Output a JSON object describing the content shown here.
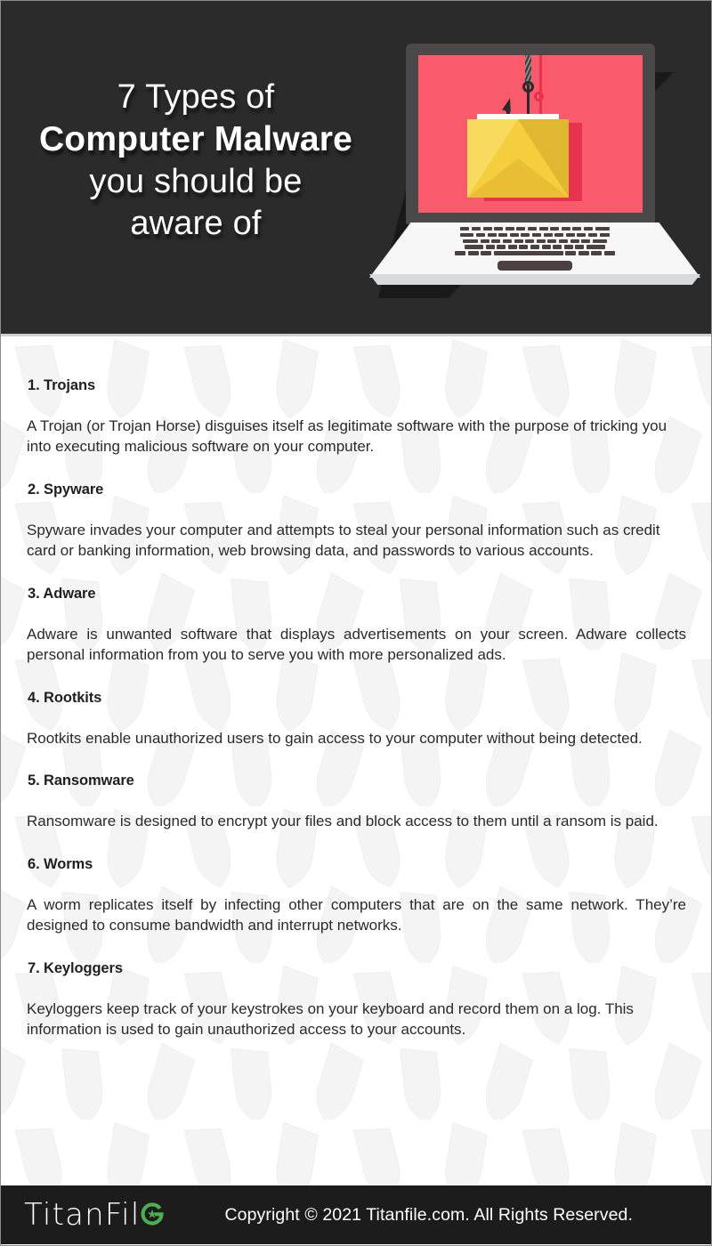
{
  "header": {
    "title_lines": [
      {
        "text": "7 Types of",
        "bold": false
      },
      {
        "text": "Computer Malware",
        "bold": true
      },
      {
        "text": "you should be",
        "bold": false
      },
      {
        "text": "aware of",
        "bold": false
      }
    ],
    "illustration": {
      "name": "phishing-email-laptop-illustration",
      "screen_color": "#fa5b6c",
      "envelope_color": "#f5ce3e",
      "hook_color": "#2b2b2b",
      "skull_color": "#2b2b2b",
      "laptop_body_color": "#f7f7f7",
      "lid_color": "#4b4849"
    },
    "background_color": "#2b2b2b"
  },
  "content": {
    "background_color": "#ffffff",
    "watermark_icon": "shield-icon",
    "sections": [
      {
        "title": "1. Trojans",
        "body": "A Trojan (or Trojan Horse) disguises itself as legitimate software with the purpose of tricking you into executing malicious software on your computer.",
        "justify": false
      },
      {
        "title": "2. Spyware",
        "body": "Spyware invades your computer and attempts to steal your personal information such as credit card or banking information, web browsing data, and passwords to various accounts.",
        "justify": false
      },
      {
        "title": "3. Adware",
        "body": "Adware is unwanted software that displays advertisements on your screen. Adware collects personal information from you to serve you with more personalized ads.",
        "justify": true
      },
      {
        "title": "4. Rootkits",
        "body": "Rootkits enable unauthorized users to gain access to your computer without being detected.",
        "justify": true
      },
      {
        "title": "5. Ransomware",
        "body": "Ransomware is designed to encrypt your files and block access to them until a ransom is paid.",
        "justify": false
      },
      {
        "title": "6. Worms",
        "body": "A worm replicates itself by infecting other computers that are on the same network. They’re designed to consume bandwidth and interrupt networks.",
        "justify": true
      },
      {
        "title": "7. Keyloggers",
        "body": "Keyloggers keep track of your keystrokes on your keyboard and record them on a log. This information is used to gain unauthorized access to your accounts.",
        "justify": false
      }
    ]
  },
  "footer": {
    "background_color": "#1c1c1c",
    "logo_text": "TitanFil",
    "logo_mark": "titanfile-e-icon",
    "logo_accent_color": "#4caf50",
    "copyright": "Copyright © 2021 Titanfile.com. All Rights Reserved."
  }
}
